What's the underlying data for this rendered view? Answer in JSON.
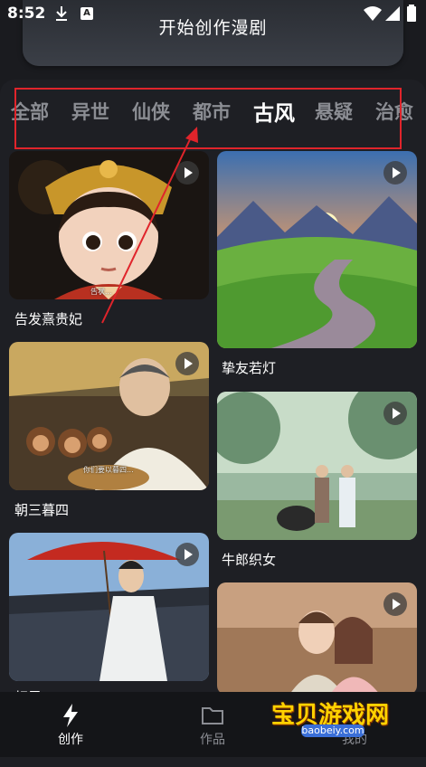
{
  "status_bar": {
    "time": "8:52",
    "notification_a": "A"
  },
  "header": {
    "create_button_label": "开始创作漫剧"
  },
  "tabs": [
    {
      "label": "全部",
      "active": false
    },
    {
      "label": "异世",
      "active": false
    },
    {
      "label": "仙侠",
      "active": false
    },
    {
      "label": "都市",
      "active": false
    },
    {
      "label": "古风",
      "active": true
    },
    {
      "label": "悬疑",
      "active": false
    },
    {
      "label": "治愈",
      "active": false
    }
  ],
  "cards": [
    {
      "title": "告发熹贵妃",
      "subtitle": "告状..."
    },
    {
      "title": "挚友若灯"
    },
    {
      "title": "朝三暮四",
      "subtitle": "你们要以暮四..."
    },
    {
      "title": "牛郎织女"
    },
    {
      "title": "相思..."
    },
    {
      "title": ""
    }
  ],
  "bottom_nav": [
    {
      "label": "创作",
      "active": true
    },
    {
      "label": "作品",
      "active": false
    },
    {
      "label": "我的",
      "active": false
    }
  ],
  "watermark": {
    "title": "宝贝游戏网",
    "url": "baobeiy.com"
  },
  "colors": {
    "highlight_box": "#e0242b",
    "arrow": "#e0242b",
    "active_tab": "#ffffff",
    "inactive_tab": "#8b8d93"
  }
}
